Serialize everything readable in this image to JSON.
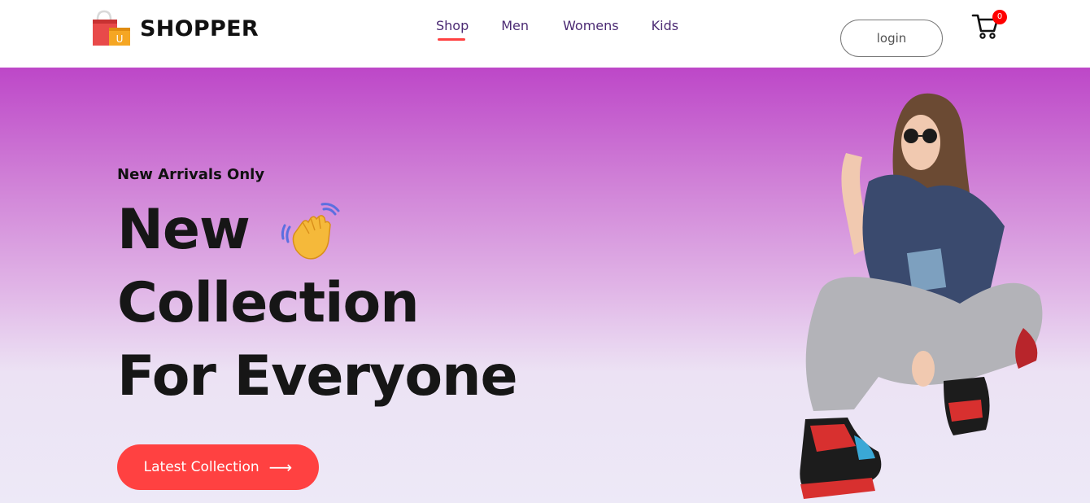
{
  "brand": {
    "name": "SHOPPER",
    "icon": "shopping-bag-icon",
    "colors": {
      "bag_red": "#e84a4a",
      "bag_yellow": "#f5a623"
    }
  },
  "nav": {
    "items": [
      {
        "label": "Shop",
        "active": true
      },
      {
        "label": "Men"
      },
      {
        "label": "Womens"
      },
      {
        "label": "Kids"
      }
    ],
    "login_label": "login",
    "cart": {
      "icon": "cart-icon",
      "count": "0"
    }
  },
  "hero": {
    "subtitle": "New Arrivals Only",
    "line1": "New",
    "line2": "Collection",
    "line3": "For Everyone",
    "hand_icon": "waving-hand-icon",
    "cta_label": "Latest Collection",
    "cta_icon": "arrow-right-icon",
    "colors": {
      "accent": "#ff4141",
      "gradient_top": "#bd47c8",
      "gradient_bottom": "#ede9f7"
    }
  }
}
